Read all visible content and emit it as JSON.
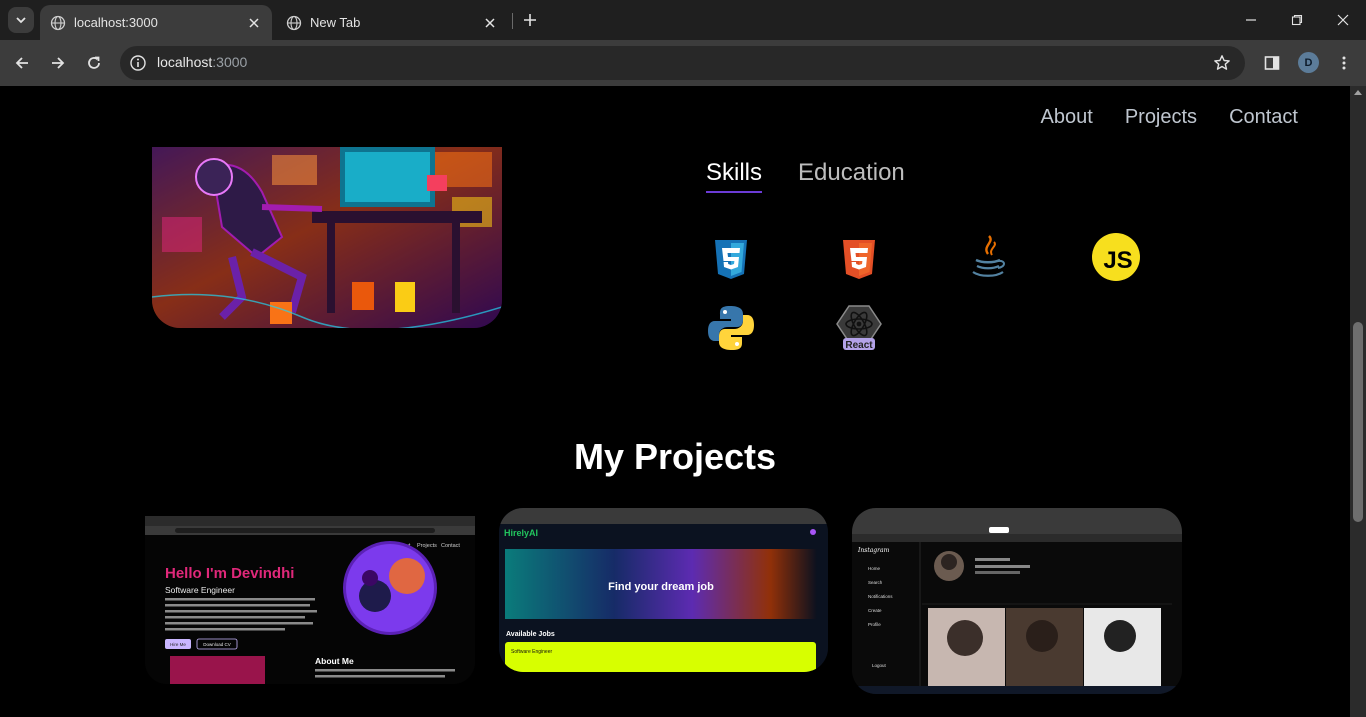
{
  "browser": {
    "tabs": [
      {
        "title": "localhost:3000",
        "active": true
      },
      {
        "title": "New Tab",
        "active": false
      }
    ],
    "url_host": "localhost",
    "url_port": ":3000",
    "profile_initial": "D"
  },
  "nav": {
    "items": [
      "About",
      "Projects",
      "Contact"
    ]
  },
  "skills": {
    "tabs": [
      "Skills",
      "Education"
    ],
    "active_tab": "Skills",
    "icons": [
      "css3-icon",
      "html5-icon",
      "java-icon",
      "javascript-icon",
      "python-icon",
      "react-icon"
    ],
    "js_label": "JS",
    "react_label": "React"
  },
  "projects": {
    "title": "My Projects",
    "cards": [
      {
        "name": "portfolio",
        "heading": "Hello I'm Devindhi",
        "subtitle": "Software Engineer",
        "nav": [
          "About",
          "Projects",
          "Contact"
        ],
        "buttons": [
          "Hire Me",
          "Download CV"
        ],
        "section": "About Me"
      },
      {
        "name": "hirelyai",
        "brand": "HirelyAI",
        "banner": "Find your dream job",
        "section": "Available Jobs",
        "job": "Software Engineer"
      },
      {
        "name": "instagram-clone",
        "brand": "Instagram",
        "menu": [
          "Home",
          "Search",
          "Notifications",
          "Create",
          "Profile"
        ],
        "logout": "Logout"
      }
    ]
  },
  "colors": {
    "background": "#000000",
    "accent": "#6b3bd6",
    "nav_text": "#bfc6cf",
    "hello_pink": "#e0287a",
    "job_lime": "#d7ff00"
  }
}
